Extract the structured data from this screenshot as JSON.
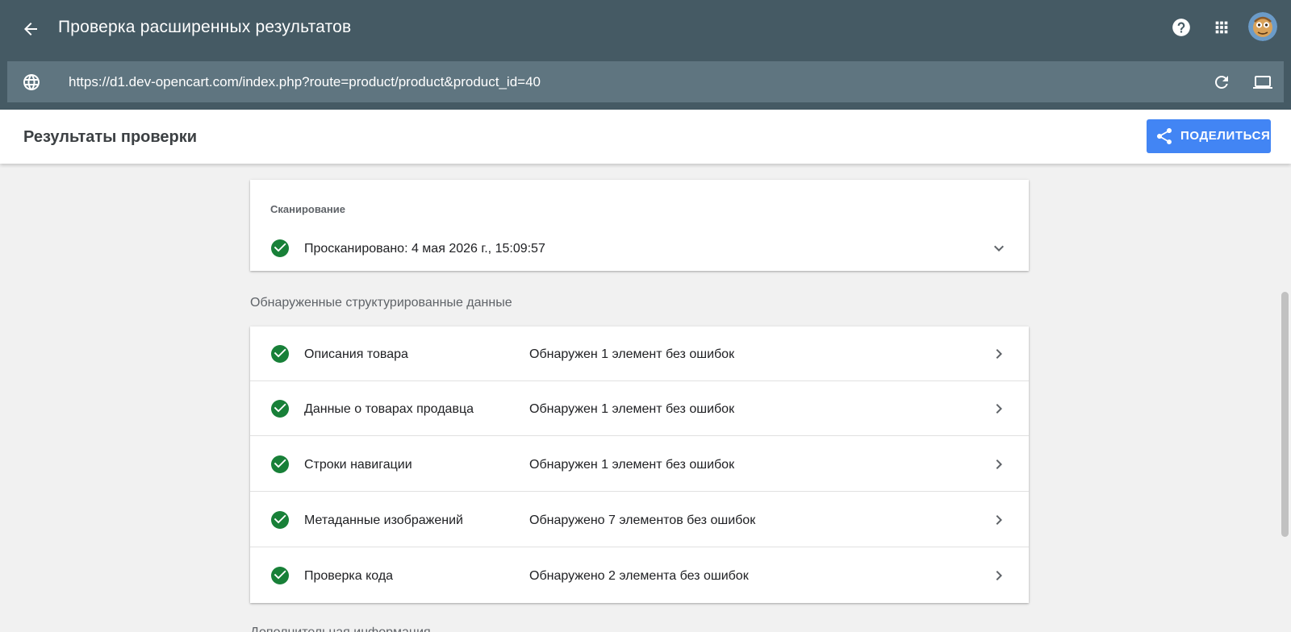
{
  "app": {
    "title": "Проверка расширенных результатов",
    "url": "https://d1.dev-opencart.com/index.php?route=product/product&product_id=40"
  },
  "header": {
    "results_title": "Результаты проверки",
    "share_label": "ПОДЕЛИТЬСЯ"
  },
  "crawl": {
    "label": "Сканирование",
    "status": "Просканировано: 4 мая 2026 г., 15:09:57"
  },
  "detected_section": {
    "label": "Обнаруженные структурированные данные",
    "items": [
      {
        "name": "Описания товара",
        "status": "Обнаружен 1 элемент без ошибок"
      },
      {
        "name": "Данные о товарах продавца",
        "status": "Обнаружен 1 элемент без ошибок"
      },
      {
        "name": "Строки навигации",
        "status": "Обнаружен 1 элемент без ошибок"
      },
      {
        "name": "Метаданные изображений",
        "status": "Обнаружено 7 элементов без ошибок"
      },
      {
        "name": "Проверка кода",
        "status": "Обнаружено 2 элемента без ошибок"
      }
    ]
  },
  "additional_section": {
    "label": "Дополнительная информация"
  },
  "icons": {
    "back": "arrow-back-icon",
    "help": "help-icon",
    "apps": "apps-grid-icon",
    "globe": "globe-icon",
    "refresh": "refresh-icon",
    "device": "laptop-icon",
    "share": "share-icon",
    "check": "check-circle-icon",
    "expand": "chevron-down-icon",
    "open": "chevron-right-icon"
  },
  "colors": {
    "appbar": "#455a64",
    "urlbar": "#5f7580",
    "accent": "#4285f4",
    "success": "#188038"
  }
}
